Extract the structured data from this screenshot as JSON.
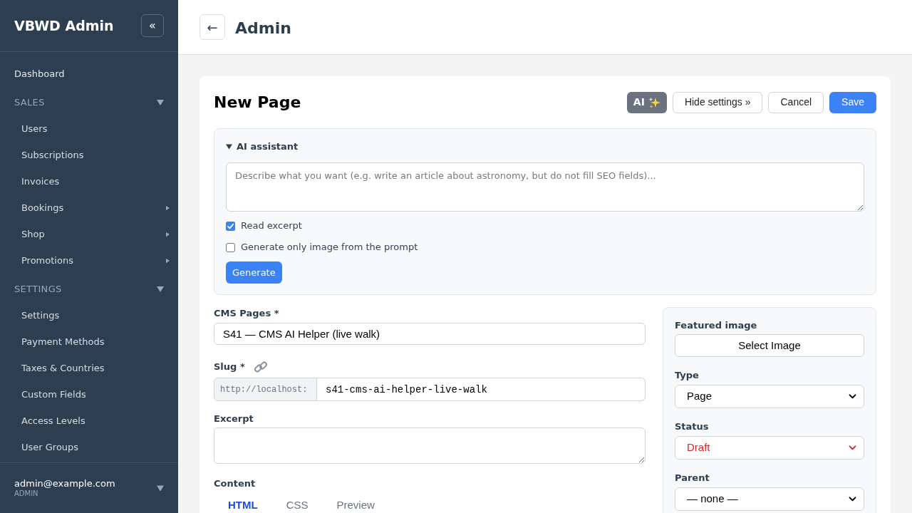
{
  "sidebar": {
    "title": "VBWD Admin",
    "collapse_button": "«",
    "items": [
      {
        "kind": "link",
        "label": "Dashboard"
      },
      {
        "kind": "group",
        "label": "SALES",
        "expanded": true,
        "children": [
          {
            "label": "Users",
            "has_submenu": false
          },
          {
            "label": "Subscriptions",
            "has_submenu": false
          },
          {
            "label": "Invoices",
            "has_submenu": false
          },
          {
            "label": "Bookings",
            "has_submenu": true
          },
          {
            "label": "Shop",
            "has_submenu": true
          },
          {
            "label": "Promotions",
            "has_submenu": true
          }
        ]
      },
      {
        "kind": "group",
        "label": "SETTINGS",
        "expanded": true,
        "children": [
          {
            "label": "Settings",
            "has_submenu": false
          },
          {
            "label": "Payment Methods",
            "has_submenu": false
          },
          {
            "label": "Taxes & Countries",
            "has_submenu": false
          },
          {
            "label": "Custom Fields",
            "has_submenu": false
          },
          {
            "label": "Access Levels",
            "has_submenu": false
          },
          {
            "label": "User Groups",
            "has_submenu": false
          }
        ]
      }
    ],
    "user": {
      "email": "admin@example.com",
      "role": "ADMIN"
    }
  },
  "header": {
    "back_button": "←",
    "title": "Admin"
  },
  "page": {
    "title": "New Page",
    "actions": [
      {
        "kind": "ai",
        "label": "AI"
      },
      {
        "kind": "secondary",
        "label": "Hide settings »"
      },
      {
        "kind": "secondary",
        "label": "Cancel"
      },
      {
        "kind": "primary",
        "label": "Save"
      }
    ]
  },
  "ai_assistant": {
    "title": "AI assistant",
    "expanded": true,
    "prompt": {
      "placeholder": "Describe what you want (e.g. write an article about astronomy, but do not fill SEO fields)..."
    },
    "options": [
      {
        "label": "Read excerpt",
        "checked": true
      },
      {
        "label": "Generate only image from the prompt",
        "checked": false
      }
    ],
    "generate_button": "Generate"
  },
  "form": {
    "title_field": {
      "label": "CMS Pages *",
      "value": "S41 — CMS AI Helper (live walk)"
    },
    "slug_field": {
      "label": "Slug *",
      "prefix": "http://localhost:",
      "value": "s41-cms-ai-helper-live-walk"
    },
    "excerpt_field": {
      "label": "Excerpt"
    },
    "content": {
      "label": "Content",
      "tabs": [
        {
          "label": "HTML",
          "selected": true
        },
        {
          "label": "CSS",
          "selected": false
        },
        {
          "label": "Preview",
          "selected": false
        }
      ]
    }
  },
  "settings_panel": {
    "fields": [
      {
        "kind": "button",
        "label": "Featured image",
        "value": "Select Image"
      },
      {
        "kind": "select",
        "label": "Type",
        "value": "Page"
      },
      {
        "kind": "select",
        "label": "Status",
        "value": "Draft",
        "color": "#dc2626"
      },
      {
        "kind": "select",
        "label": "Parent",
        "value": "— none —"
      }
    ]
  }
}
